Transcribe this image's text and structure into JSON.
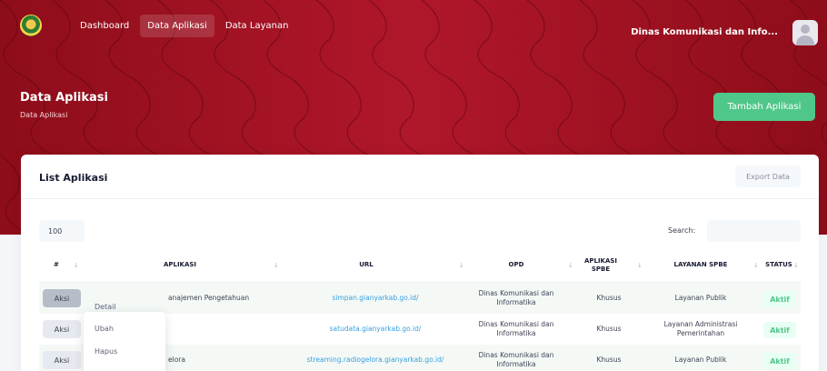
{
  "nav": {
    "items": [
      "Dashboard",
      "Data Aplikasi",
      "Data Layanan"
    ],
    "active_index": 1,
    "user_name": "Dinas Komunikasi dan Info..."
  },
  "page": {
    "title": "Data Aplikasi",
    "breadcrumb": "Data Aplikasi",
    "add_button": "Tambah Aplikasi"
  },
  "card": {
    "title": "List Aplikasi",
    "export_button": "Export Data",
    "page_length": "100",
    "search_label": "Search:",
    "search_value": ""
  },
  "table": {
    "columns": [
      "#",
      "APLIKASI",
      "URL",
      "OPD",
      "APLIKASI SPBE",
      "LAYANAN SPBE",
      "STATUS"
    ],
    "rows": [
      {
        "action": "Aksi",
        "aplikasi": "anajemen Pengetahuan",
        "url": "simpan.gianyarkab.go.id/",
        "opd": "Dinas Komunikasi dan Informatika",
        "spbe": "Khusus",
        "layanan": "Layanan Publik",
        "status": "Aktif"
      },
      {
        "action": "Aksi",
        "aplikasi": "",
        "url": "satudata.gianyarkab.go.id/",
        "opd": "Dinas Komunikasi dan Informatika",
        "spbe": "Khusus",
        "layanan": "Layanan Administrasi Pemerintahan",
        "status": "Aktif"
      },
      {
        "action": "Aksi",
        "aplikasi": "elora",
        "url": "streaming.radiogelora.gianyarkab.go.id/",
        "opd": "Dinas Komunikasi dan Informatika",
        "spbe": "Khusus",
        "layanan": "Layanan Publik",
        "status": "Aktif"
      }
    ]
  },
  "dropdown": {
    "items": [
      "Detail",
      "Ubah",
      "Hapus"
    ]
  },
  "colors": {
    "brand_red": "#a11220",
    "success_green": "#4fc78a",
    "link_blue": "#3aa0e0"
  }
}
